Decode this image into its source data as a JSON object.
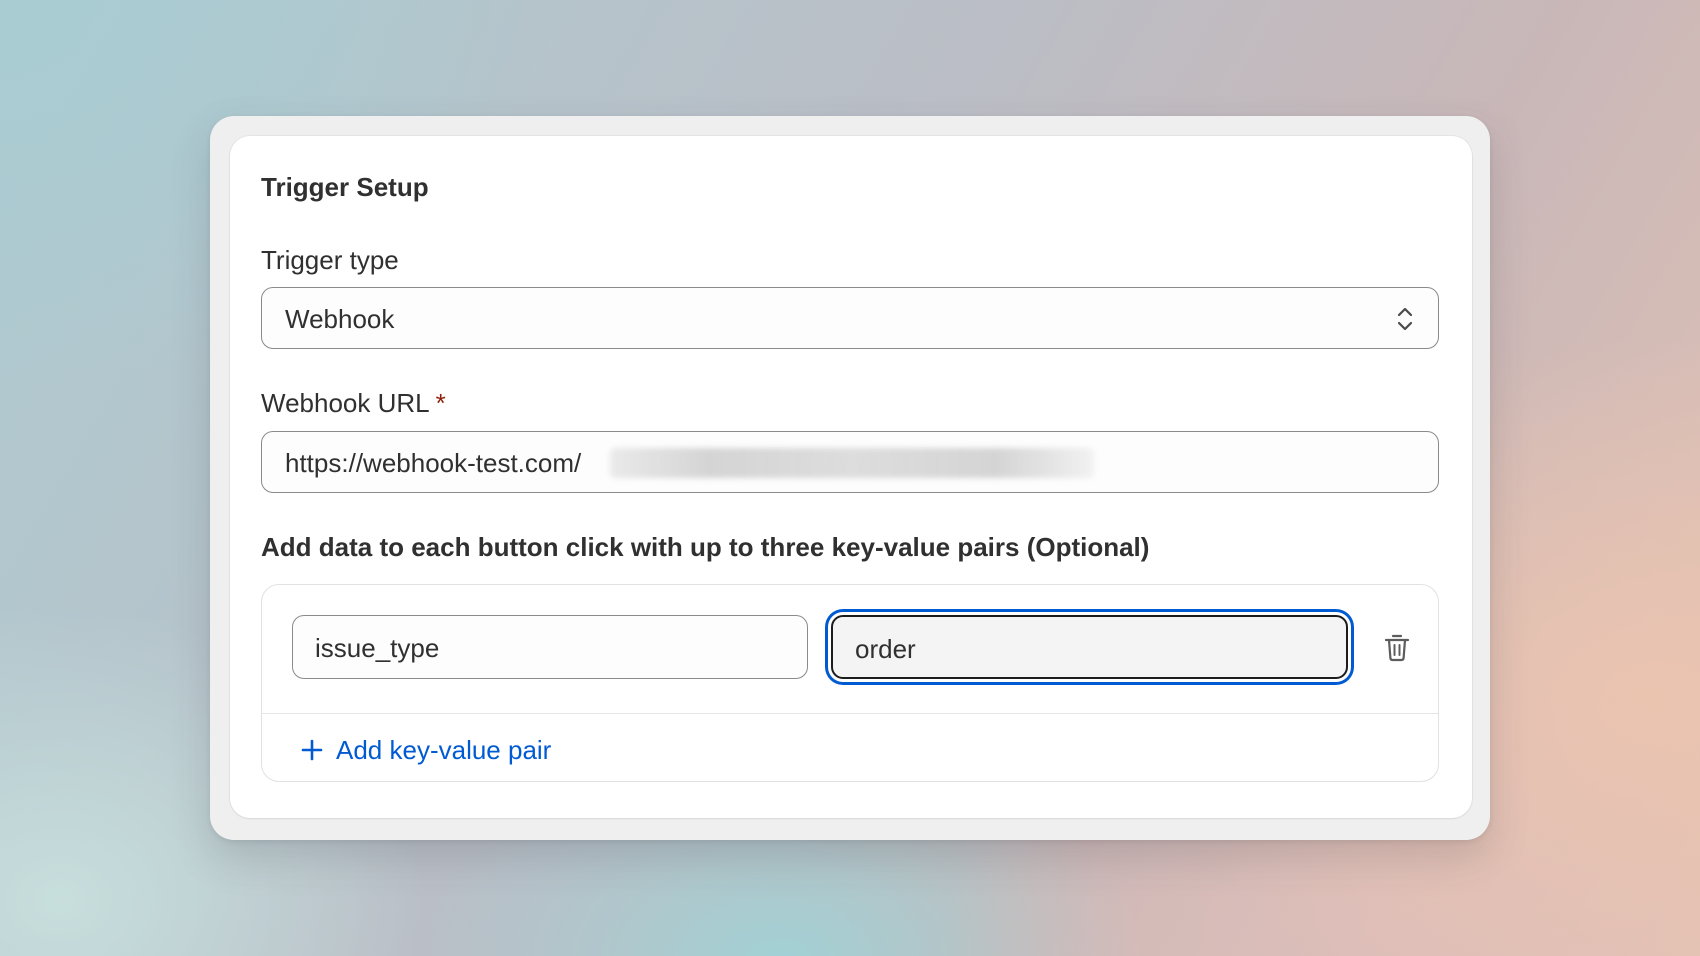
{
  "trigger_setup": {
    "title": "Trigger Setup",
    "trigger_type": {
      "label": "Trigger type",
      "value": "Webhook"
    },
    "webhook_url": {
      "label": "Webhook URL",
      "required_marker": "*",
      "value_visible": "https://webhook-test.com/"
    },
    "key_value": {
      "heading": "Add data to each button click with up to three key-value pairs (Optional)",
      "pairs": [
        {
          "key": "issue_type",
          "value": "order"
        }
      ],
      "add_label": "Add key-value pair"
    }
  },
  "icons": {
    "select": "chevron-up-down-icon",
    "delete": "trash-icon",
    "add": "plus-icon"
  },
  "colors": {
    "accent": "#005bd3",
    "required": "#8e1f0b",
    "text": "#303030"
  }
}
